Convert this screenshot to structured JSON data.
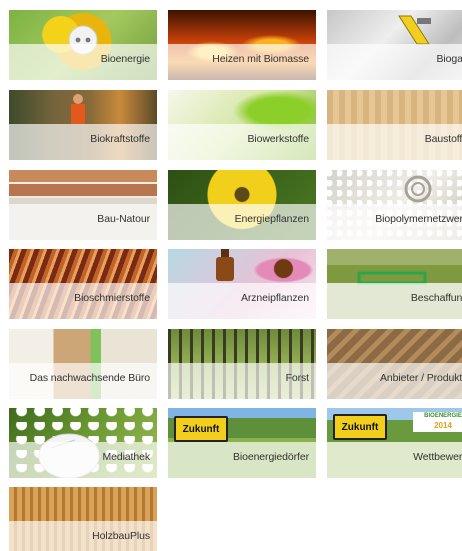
{
  "tiles": [
    {
      "label": "Bioenergie",
      "icon": "sunflower-plug-icon"
    },
    {
      "label": "Heizen mit Biomasse",
      "icon": "fire-icon"
    },
    {
      "label": "Biogas",
      "icon": "biogas-meter-icon"
    },
    {
      "label": "Biokraftstoffe",
      "icon": "fuel-station-icon"
    },
    {
      "label": "Biowerkstoffe",
      "icon": "leaf-icon"
    },
    {
      "label": "Baustoffe",
      "icon": "timber-icon"
    },
    {
      "label": "Bau-Natour",
      "icon": "shelf-icon"
    },
    {
      "label": "Energiepflanzen",
      "icon": "flower-icon"
    },
    {
      "label": "Biopolymernetzwerk",
      "icon": "granules-icon"
    },
    {
      "label": "Bioschmierstoffe",
      "icon": "gear-lubricant-icon"
    },
    {
      "label": "Arzneipflanzen",
      "icon": "medicine-bottle-icon"
    },
    {
      "label": "Beschaffung",
      "icon": "shopping-cart-icon"
    },
    {
      "label": "Das nachwachsende Büro",
      "icon": "office-icon"
    },
    {
      "label": "Forst",
      "icon": "forest-icon"
    },
    {
      "label": "Anbieter / Produkte",
      "icon": "logs-icon"
    },
    {
      "label": "Mediathek",
      "icon": "mouse-icon"
    },
    {
      "label": "Bioenergiedörfer",
      "icon": "zukunft-sign-icon"
    },
    {
      "label": "Wettbewerb",
      "icon": "zukunft-sign-logo-icon"
    },
    {
      "label": "HolzbauPlus",
      "icon": "wood-building-icon"
    }
  ],
  "signs": {
    "zukunft": "Zukunft",
    "logo_line1": "BIOENERGIE",
    "logo_line2": "2014"
  },
  "colors": {
    "label_text": "#333333",
    "band": "#ffffff"
  }
}
